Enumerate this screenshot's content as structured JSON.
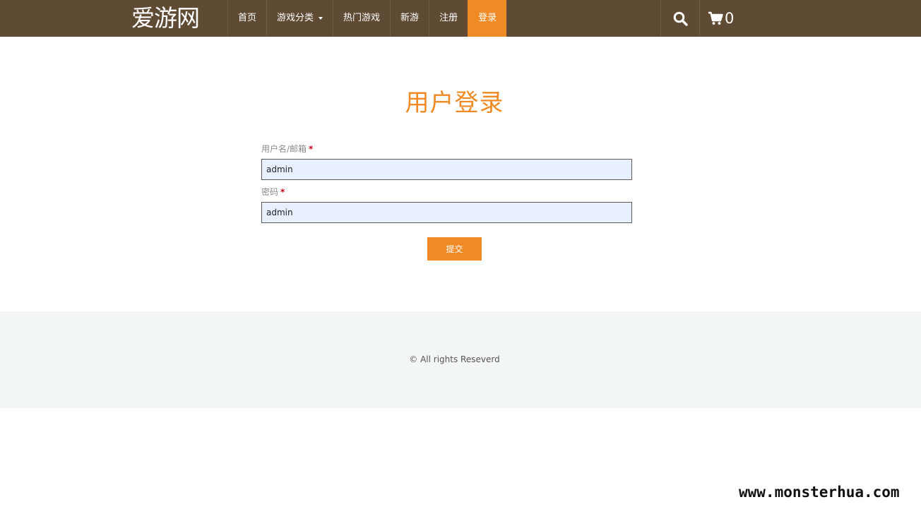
{
  "header": {
    "brand": "爱游网",
    "nav": [
      {
        "label": "首页"
      },
      {
        "label": "游戏分类",
        "dropdown": true
      },
      {
        "label": "热门游戏"
      },
      {
        "label": "新游"
      },
      {
        "label": "注册"
      },
      {
        "label": "登录",
        "active": true
      }
    ],
    "search_icon": "search-icon",
    "cart_icon": "cart-icon",
    "cart_count": "0"
  },
  "main": {
    "title": "用户登录",
    "username_label": "用户名/邮箱",
    "username_value": "admin",
    "password_label": "密码",
    "password_value": "admin",
    "required_mark": "*",
    "submit_label": "提交"
  },
  "footer": {
    "copyright": "© All rights Reseverd"
  },
  "watermark": "www.monsterhua.com",
  "colors": {
    "header_bg": "#5f4b34",
    "accent": "#f08a24",
    "input_bg": "#e8f0fe",
    "footer_bg": "#f3f6f6"
  }
}
